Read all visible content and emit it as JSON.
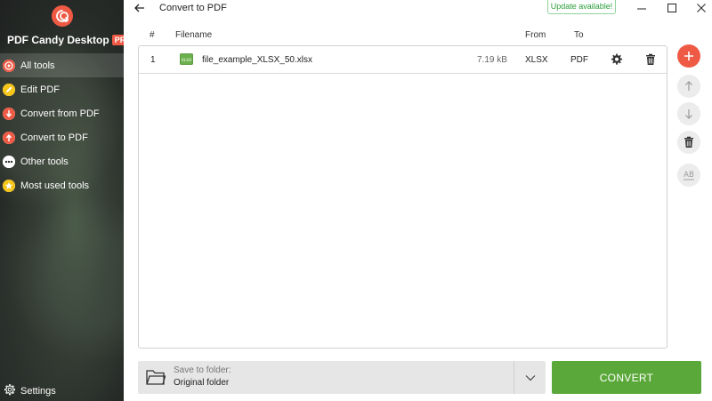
{
  "app": {
    "brand_name": "PDF Candy Desktop",
    "pro_badge": "PRO"
  },
  "sidebar": {
    "items": [
      {
        "label": "All tools",
        "icon": "all-tools-icon",
        "active": true
      },
      {
        "label": "Edit PDF",
        "icon": "edit-pdf-icon",
        "active": false
      },
      {
        "label": "Convert from PDF",
        "icon": "convert-from-pdf-icon",
        "active": false
      },
      {
        "label": "Convert to PDF",
        "icon": "convert-to-pdf-icon",
        "active": false
      },
      {
        "label": "Other tools",
        "icon": "other-tools-icon",
        "active": false
      },
      {
        "label": "Most used tools",
        "icon": "star-icon",
        "active": false
      }
    ],
    "settings_label": "Settings"
  },
  "header": {
    "title": "Convert to PDF",
    "update_badge": "Update available!"
  },
  "table": {
    "columns": {
      "num": "#",
      "filename": "Filename",
      "from": "From",
      "to": "To"
    },
    "rows": [
      {
        "num": "1",
        "filename": "file_example_XLSX_50.xlsx",
        "size": "7.19 kB",
        "from": "XLSX",
        "to": "PDF",
        "file_icon_label": "XLSX"
      }
    ]
  },
  "footer": {
    "save_label": "Save to folder:",
    "save_value": "Original folder",
    "convert_label": "CONVERT"
  },
  "colors": {
    "accent": "#ef5a45",
    "convert_green": "#5ba83a",
    "update_green": "#2e9e3e"
  }
}
